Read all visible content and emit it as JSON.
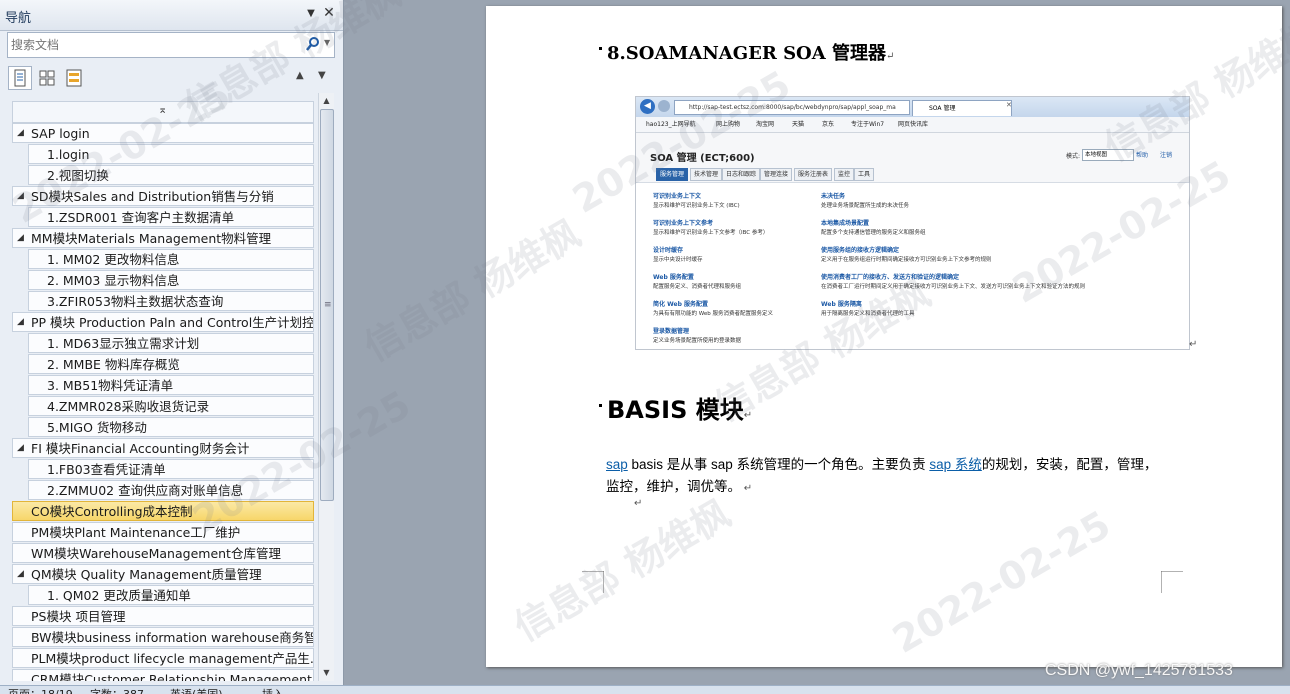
{
  "nav": {
    "title": "导航",
    "search_placeholder": "搜索文档",
    "tree": [
      {
        "label": "SAP login",
        "level": 0,
        "expanded": true
      },
      {
        "label": "1.login",
        "level": 1
      },
      {
        "label": "2.视图切换",
        "level": 1
      },
      {
        "label": "SD模块Sales and Distribution销售与分销",
        "level": 0,
        "expanded": true
      },
      {
        "label": "1.ZSDR001 查询客户主数据清单",
        "level": 1
      },
      {
        "label": "MM模块Materials Management物料管理",
        "level": 0,
        "expanded": true
      },
      {
        "label": "1. MM02 更改物料信息",
        "level": 1
      },
      {
        "label": "2. MM03 显示物料信息",
        "level": 1
      },
      {
        "label": "3.ZFIR053物料主数据状态查询",
        "level": 1
      },
      {
        "label": "PP 模块 Production Paln and Control生产计划控...",
        "level": 0,
        "expanded": true
      },
      {
        "label": "1. MD63显示独立需求计划",
        "level": 1
      },
      {
        "label": "2. MMBE 物料库存概览",
        "level": 1
      },
      {
        "label": "3. MB51物料凭证清单",
        "level": 1
      },
      {
        "label": "4.ZMMR028采购收退货记录",
        "level": 1
      },
      {
        "label": "5.MIGO 货物移动",
        "level": 1
      },
      {
        "label": "FI 模块Financial Accounting财务会计",
        "level": 0,
        "expanded": true
      },
      {
        "label": "1.FB03查看凭证清单",
        "level": 1
      },
      {
        "label": "2.ZMMU02 查询供应商对账单信息",
        "level": 1
      },
      {
        "label": "CO模块Controlling成本控制",
        "level": 0,
        "selected": true
      },
      {
        "label": "PM模块Plant Maintenance工厂维护",
        "level": 0
      },
      {
        "label": "WM模块WarehouseManagement仓库管理",
        "level": 0
      },
      {
        "label": "QM模块 Quality Management质量管理",
        "level": 0,
        "expanded": true
      },
      {
        "label": "1. QM02 更改质量通知单",
        "level": 1
      },
      {
        "label": "PS模块 项目管理",
        "level": 0
      },
      {
        "label": "BW模块business information warehouse商务智能",
        "level": 0
      },
      {
        "label": "PLM模块product lifecycle management产品生...",
        "level": 0
      },
      {
        "label": "CRM模块Customer Relationship Management...",
        "level": 0
      }
    ]
  },
  "doc": {
    "heading1": "8.SOAMANAGER SOA 管理器",
    "heading2": "BASIS 模块",
    "para_link1": "sap",
    "para_text1": " basis 是从事 sap 系统管理的一个角色。主要负责 ",
    "para_link2": "sap 系统",
    "para_text2": "的规划，安装，配置，管理，监控，维护，调优等。"
  },
  "screenshot": {
    "url": "http://sap-test.ectsz.com:8000/sap/bc/webdynpro/sap/appl_soap_ma",
    "tab": "SOA 管理",
    "favorites": [
      "hao123_上网导航",
      "网上购物",
      "淘宝网",
      "天猫",
      "京东",
      "专注于Win7",
      "网页快讯库"
    ],
    "app_title": "SOA 管理 (ECT;600)",
    "mode_label": "模式:",
    "mode_value": "本地视图",
    "help": "帮助",
    "logout": "注销",
    "tabs": [
      "服务管理",
      "技术管理",
      "日志和跟踪",
      "管理连接",
      "服务注册表",
      "监控",
      "工具"
    ],
    "left_items": [
      {
        "title": "可识别业务上下文",
        "desc": "显示和维护可识别业务上下文 (IBC)"
      },
      {
        "title": "可识别业务上下文参考",
        "desc": "显示和维护可识别业务上下文参考（IBC 参考）"
      },
      {
        "title": "设计时缓存",
        "desc": "显示中央设计时缓存"
      },
      {
        "title": "Web 服务配置",
        "desc": "配置服务定义、消费者代理和服务组"
      },
      {
        "title": "简化 Web 服务配置",
        "desc": "为具有有限功能的 Web 服务消费者配置服务定义"
      },
      {
        "title": "登录数据管理",
        "desc": "定义业务场景配置所使用的登录数据"
      }
    ],
    "right_items": [
      {
        "title": "未决任务",
        "desc": "处理业务场景配置所生成的未决任务"
      },
      {
        "title": "本地集成场景配置",
        "desc": "配置多个支持通信管理的服务定义和服务组"
      },
      {
        "title": "使用服务组的接收方逻辑确定",
        "desc": "定义用于在服务组运行时期间确定接收方可识别业务上下文参考的规则"
      },
      {
        "title": "使用消费者工厂的接收方、发送方和验证的逻辑确定",
        "desc": "在消费者工厂运行时期间定义用于确定接收方可识别业务上下文、发送方可识别业务上下文和验证方法的规则"
      },
      {
        "title": "Web 服务隔离",
        "desc": "用于隔离服务定义和消费者代理的工具"
      }
    ]
  },
  "watermark": {
    "name": "信息部 杨维枫",
    "date": "2022-02-25"
  },
  "csdn": "CSDN @ywf_1425781533",
  "status": {
    "page": "页面：18/19",
    "words": "字数：387",
    "lang": "英语(美国)",
    "mode": "插入"
  },
  "colors": {
    "selected_item": "#f7d66a",
    "link": "#0b5ea8"
  }
}
